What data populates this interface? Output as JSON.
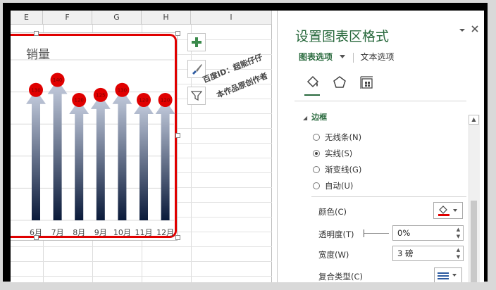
{
  "spreadsheet": {
    "column_headers": [
      "E",
      "F",
      "G",
      "H",
      "I"
    ],
    "chart_title": "销量"
  },
  "chart_data": {
    "type": "bar",
    "title": "销量",
    "categories": [
      "6月",
      "7月",
      "8月",
      "9月",
      "10月",
      "11月",
      "12月"
    ],
    "values": [
      130,
      140,
      120,
      125,
      130,
      120,
      120
    ],
    "marker_labels": [
      "130",
      "140",
      "120",
      "125",
      "130",
      "120",
      "120"
    ],
    "ylim": [
      0,
      160
    ],
    "bar_style": "arrow",
    "gradient_colors": [
      "#0a1a3a",
      "#c7cfe0"
    ],
    "marker_color": "#e00000",
    "grid": true,
    "legend": "none"
  },
  "chart_side_buttons": {
    "add_icon": "plus-icon",
    "style_icon": "brush-icon",
    "filter_icon": "funnel-icon"
  },
  "watermark": {
    "line1": "百度ID：超能仔仔",
    "line2": "本作品原创作者"
  },
  "format_panel": {
    "title": "设置图表区格式",
    "dropdown_icon": "chevron-down-icon",
    "close_icon": "close-icon",
    "tab_chart_options": "图表选项",
    "tab_text_options": "文本选项",
    "icons": [
      "fill-line-icon",
      "effects-pentagon-icon",
      "size-properties-icon"
    ],
    "section_title": "边框",
    "line_options": [
      {
        "label": "无线条(N)",
        "selected": false
      },
      {
        "label": "实线(S)",
        "selected": true
      },
      {
        "label": "渐变线(G)",
        "selected": false
      },
      {
        "label": "自动(U)",
        "selected": false
      }
    ],
    "color_label": "颜色(C)",
    "color_value": "#e00000",
    "transparency_label": "透明度(T)",
    "transparency_value": "0%",
    "width_label": "宽度(W)",
    "width_value": "3 磅",
    "compound_label": "复合类型(C)"
  },
  "colors": {
    "accent": "#2a6a3e",
    "chart_border": "#e00000"
  }
}
